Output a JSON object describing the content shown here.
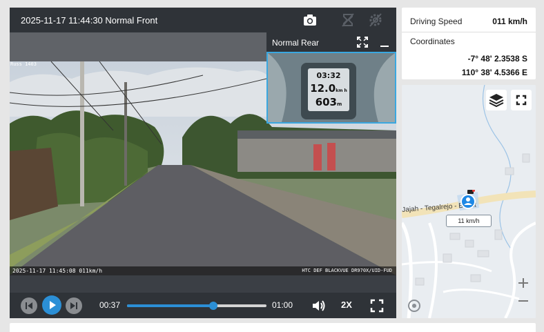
{
  "player": {
    "front_title": "2025-11-17 11:44:30 Normal Front",
    "rear_title": "Normal Rear",
    "camera_name": "Russ 1403",
    "overlay_left": "2025-11-17 11:45:08 011km/h",
    "overlay_right": "HTC DEF BLACKVUE DR970X/UID-FUD",
    "rear_gps": {
      "time": "03:32",
      "speed_value": "12.0",
      "speed_unit": "km h",
      "distance_value": "603",
      "distance_unit": "m"
    },
    "time_current": "00:37",
    "time_total": "01:00",
    "progress": 0.617,
    "playback_rate": "2X"
  },
  "info": {
    "speed_label": "Driving Speed",
    "speed_value": "011 km/h",
    "coords_label": "Coordinates",
    "latitude": "-7° 48' 2.3538 S",
    "longitude": "110° 38' 4.5366 E"
  },
  "map": {
    "road_label": "Jajah - Tegalrejo - Bayat",
    "speed_tag": "11 km/h"
  },
  "colors": {
    "accent": "#2b8fd6",
    "header_bg": "#2f3338",
    "pip_border": "#3aa7e0"
  },
  "icons": [
    "camera-icon",
    "hourglass-icon",
    "gear-icon",
    "expand-icon",
    "minimize-icon",
    "previous-icon",
    "play-icon",
    "next-icon",
    "volume-icon",
    "fullscreen-icon",
    "layers-icon",
    "map-fullscreen-icon",
    "location-icon",
    "zoom-in-icon",
    "zoom-out-icon"
  ]
}
